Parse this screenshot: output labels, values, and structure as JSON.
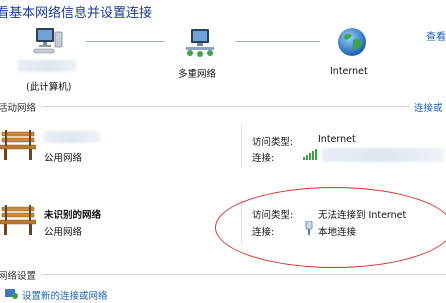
{
  "header": {
    "title": "看基本网络信息并设置连接",
    "top_right_link": "查看"
  },
  "map": {
    "computer_label": "(此计算机)",
    "multi_network_label": "多重网络",
    "internet_label": "Internet"
  },
  "active_section": {
    "label": "活动网络",
    "right_link": "连接或"
  },
  "networks": [
    {
      "name": "",
      "type": "公用网络",
      "access_type_label": "访问类型:",
      "access_type_value": "Internet",
      "connection_label": "连接:",
      "connection_value": ""
    },
    {
      "name": "未识别的网络",
      "type": "公用网络",
      "access_type_label": "访问类型:",
      "access_type_value": "无法连接到 Internet",
      "connection_label": "连接:",
      "connection_value": "本地连接"
    }
  ],
  "settings_section": {
    "label": "网络设置",
    "first_item": "设置新的连接或网络"
  },
  "colors": {
    "accent_link": "#1e5fb3",
    "title_blue": "#1e3b8b",
    "annotation_red": "#d0342c"
  }
}
